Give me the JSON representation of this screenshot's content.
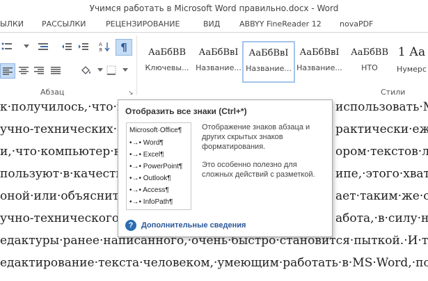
{
  "window": {
    "title": "Учимся работать в Microsoft Word правильно.docx - Word"
  },
  "tabs": [
    "ЫЛКИ",
    "РАССЫЛКИ",
    "РЕЦЕНЗИРОВАНИЕ",
    "ВИД",
    "ABBYY FineReader 12",
    "novaPDF"
  ],
  "ribbon": {
    "paragraph_group_label": "Абзац",
    "styles_group_label": "Стили",
    "show_marks_glyph": "¶",
    "styles": [
      {
        "sample": "АаБбВВ",
        "name": "Ключевы..."
      },
      {
        "sample": "АаБбВвІ",
        "name": "Название..."
      },
      {
        "sample": "АаБбВвІ",
        "name": "Название..."
      },
      {
        "sample": "АаБбВвІ",
        "name": "Название..."
      },
      {
        "sample": "АаБбВВ",
        "name": "НТО"
      },
      {
        "sample": "1 Аа",
        "name": "Нумерс"
      }
    ]
  },
  "document": {
    "lines": [
      "к·получилось,·что·по",
      "учно-технических·от",
      "и,·что·компьютер·вм",
      "пользуют·в·качестве",
      "оной·или·объяснител",
      "учно-технического·с",
      "едактуры·ранее·написанного,·очень·быстро·становится·пыткой.·И·такой",
      "едактирование·текста·человеком,·умеющим·работать·в·MS·Word,·после·прав"
    ],
    "lines_right": [
      "использовать·MS",
      "рактически·ежед",
      "ором·текстов·лю",
      "ипе,·этого·хватае",
      "ает·таким·же·об",
      "абота,·в·силу·необ"
    ]
  },
  "tooltip": {
    "title": "Отобразить все знаки (Ctrl+*)",
    "preview": {
      "heading": "Microsoft·Office¶",
      "items": [
        "Word¶",
        "Excel¶",
        "PowerPoint¶",
        "Outlook¶",
        "Access¶",
        "InfoPath¶"
      ],
      "arrow": "•→•"
    },
    "description_1": "Отображение знаков абзаца и других скрытых знаков форматирования.",
    "description_2": "Это особенно полезно для сложных действий с разметкой.",
    "help_icon": "?",
    "help_link": "Дополнительные сведения"
  }
}
